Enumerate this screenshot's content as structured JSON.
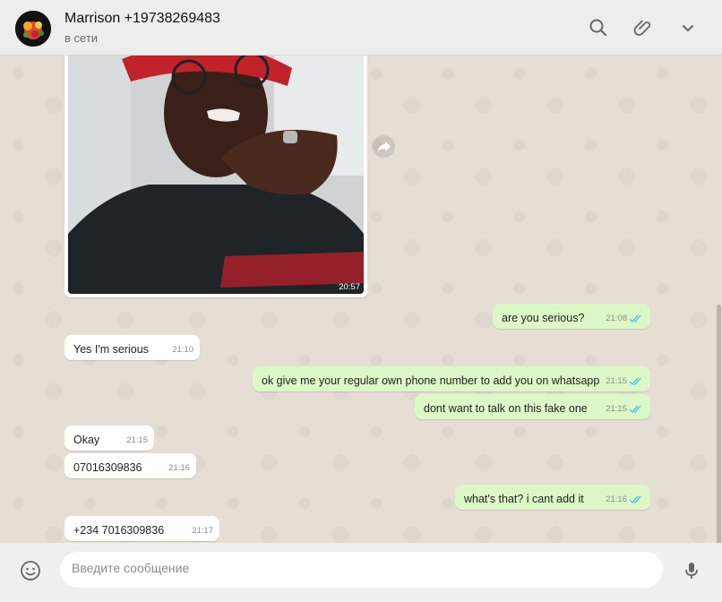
{
  "header": {
    "contact_name": "Marrison +19738269483",
    "status": "в сети"
  },
  "photo": {
    "time": "20:57"
  },
  "messages": [
    {
      "direction": "out",
      "text": "are you serious?",
      "time": "21:08",
      "read": true
    },
    {
      "direction": "in",
      "text": "Yes I'm serious",
      "time": "21:10"
    },
    {
      "direction": "out",
      "text": "ok give me your regular own phone number to add you on whatsapp",
      "time": "21:15",
      "read": true
    },
    {
      "direction": "out",
      "text": "dont want to talk on this fake one",
      "time": "21:15",
      "read": true
    },
    {
      "direction": "in",
      "text": "Okay",
      "time": "21:15"
    },
    {
      "direction": "in",
      "text": "07016309836",
      "time": "21:16"
    },
    {
      "direction": "out",
      "text": "what's that? i cant add it",
      "time": "21:16",
      "read": true
    },
    {
      "direction": "in",
      "text": "+234 7016309836",
      "time": "21:17"
    }
  ],
  "composer": {
    "placeholder": "Введите сообщение"
  },
  "icons": {
    "search": "search-icon",
    "attach": "paperclip-icon",
    "menu": "chevron-down-icon",
    "emoji": "emoji-icon",
    "mic": "microphone-icon",
    "forward": "forward-icon"
  },
  "colors": {
    "outgoing_bubble": "#dcf8c6",
    "incoming_bubble": "#ffffff",
    "read_ticks": "#4fc3f7",
    "chat_bg": "#e5ddd5"
  }
}
